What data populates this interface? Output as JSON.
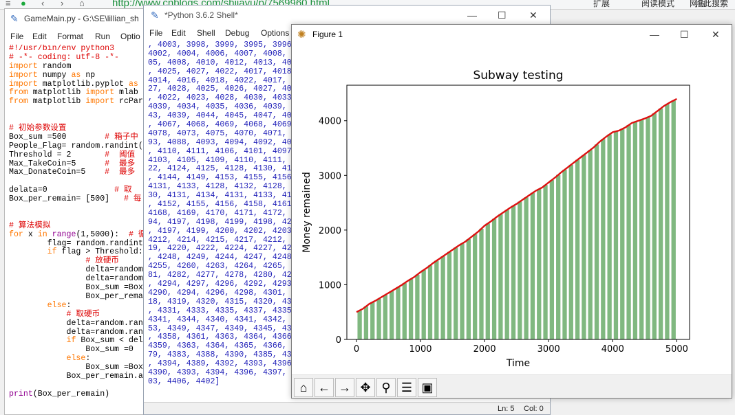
{
  "browser": {
    "url": "http://www.cnblogs.com/shiiayu/p/7569960.html",
    "right_items": [
      "扩展",
      "阅读模式",
      "网银",
      "点此搜索"
    ]
  },
  "editor": {
    "title": "GameMain.py - G:\\SE\\lillian_sh",
    "menu": [
      "File",
      "Edit",
      "Format",
      "Run",
      "Optio"
    ],
    "lines": [
      [
        [
          "cm",
          "#!/usr/bin/env python3"
        ]
      ],
      [
        [
          "cm",
          "# -*- coding: utf-8 -*-"
        ]
      ],
      [
        [
          "kw",
          "import"
        ],
        [
          "pl",
          " random"
        ]
      ],
      [
        [
          "kw",
          "import"
        ],
        [
          "pl",
          " numpy "
        ],
        [
          "kw",
          "as"
        ],
        [
          "pl",
          " np"
        ]
      ],
      [
        [
          "kw",
          "import"
        ],
        [
          "pl",
          " matplotlib.pyplot "
        ],
        [
          "kw",
          "as"
        ]
      ],
      [
        [
          "kw",
          "from"
        ],
        [
          "pl",
          " matplotlib "
        ],
        [
          "kw",
          "import"
        ],
        [
          "pl",
          " mlab"
        ]
      ],
      [
        [
          "kw",
          "from"
        ],
        [
          "pl",
          " matplotlib "
        ],
        [
          "kw",
          "import"
        ],
        [
          "pl",
          " rcPar"
        ]
      ],
      [
        [
          "pl",
          ""
        ]
      ],
      [
        [
          "pl",
          ""
        ]
      ],
      [
        [
          "cm",
          "# 初始参数设置"
        ]
      ],
      [
        [
          "pl",
          "Box_sum =500        "
        ],
        [
          "cm",
          "# 箱子中"
        ]
      ],
      [
        [
          "pl",
          "People_Flag= random.randint("
        ]
      ],
      [
        [
          "pl",
          "Threshold = 2       "
        ],
        [
          "cm",
          "#  阈值"
        ]
      ],
      [
        [
          "pl",
          "Max_TakeCoin=5      "
        ],
        [
          "cm",
          "#  最多"
        ]
      ],
      [
        [
          "pl",
          "Max_DonateCoin=5    "
        ],
        [
          "cm",
          "#  最多"
        ]
      ],
      [
        [
          "pl",
          ""
        ]
      ],
      [
        [
          "pl",
          "delata=0              "
        ],
        [
          "cm",
          "# 取"
        ]
      ],
      [
        [
          "pl",
          "Box_per_remain= [500]   "
        ],
        [
          "cm",
          "# 每"
        ]
      ],
      [
        [
          "pl",
          ""
        ]
      ],
      [
        [
          "pl",
          ""
        ]
      ],
      [
        [
          "cm",
          "# 算法模拟"
        ]
      ],
      [
        [
          "kw",
          "for"
        ],
        [
          "pl",
          " x "
        ],
        [
          "kw",
          "in"
        ],
        [
          "pl",
          " "
        ],
        [
          "bi",
          "range"
        ],
        [
          "pl",
          "(1,5000):  "
        ],
        [
          "cm",
          "# 循"
        ]
      ],
      [
        [
          "pl",
          "        flag= random.randint"
        ]
      ],
      [
        [
          "pl",
          "        "
        ],
        [
          "kw",
          "if"
        ],
        [
          "pl",
          " flag > Threshold:"
        ]
      ],
      [
        [
          "pl",
          "                "
        ],
        [
          "cm",
          "# 放硬币"
        ]
      ],
      [
        [
          "pl",
          "                delta=random"
        ]
      ],
      [
        [
          "pl",
          "                delta=random"
        ]
      ],
      [
        [
          "pl",
          "                Box_sum =Box"
        ]
      ],
      [
        [
          "pl",
          "                Box_per_rema"
        ]
      ],
      [
        [
          "pl",
          "        "
        ],
        [
          "kw",
          "else"
        ],
        [
          "pl",
          ":"
        ]
      ],
      [
        [
          "pl",
          "            "
        ],
        [
          "cm",
          "# 取硬币"
        ]
      ],
      [
        [
          "pl",
          "            delta=random.ran"
        ]
      ],
      [
        [
          "pl",
          "            delta=random.ran"
        ]
      ],
      [
        [
          "pl",
          "            "
        ],
        [
          "kw",
          "if"
        ],
        [
          "pl",
          " Box_sum < del"
        ]
      ],
      [
        [
          "pl",
          "                Box_sum =0"
        ]
      ],
      [
        [
          "pl",
          "            "
        ],
        [
          "kw",
          "else"
        ],
        [
          "pl",
          ":"
        ]
      ],
      [
        [
          "pl",
          "                Box_sum =Box"
        ]
      ],
      [
        [
          "pl",
          "            Box_per_remain.a"
        ]
      ],
      [
        [
          "pl",
          ""
        ]
      ],
      [
        [
          "bi",
          "print"
        ],
        [
          "pl",
          "(Box_per_remain)"
        ]
      ]
    ]
  },
  "shell": {
    "title": "*Python 3.6.2 Shell*",
    "menu": [
      "File",
      "Edit",
      "Shell",
      "Debug",
      "Options"
    ],
    "output": [
      ", 4003, 3998, 3999, 3995, 3996",
      "4002, 4004, 4006, 4007, 4008,",
      "05, 4008, 4010, 4012, 4013, 40",
      ", 4025, 4027, 4022, 4017, 4018",
      "4014, 4016, 4018, 4022, 4017,",
      "27, 4028, 4025, 4026, 4027, 40",
      ", 4022, 4023, 4028, 4030, 4033",
      "4039, 4034, 4035, 4036, 4039,",
      "43, 4039, 4044, 4045, 4047, 40",
      ", 4067, 4068, 4069, 4068, 4069",
      "4078, 4073, 4075, 4070, 4071,",
      "93, 4088, 4093, 4094, 4092, 40",
      ", 4110, 4111, 4106, 4101, 4097",
      "4103, 4105, 4109, 4110, 4111,",
      "22, 4124, 4125, 4128, 4130, 41",
      ", 4144, 4149, 4153, 4155, 4156",
      "4131, 4133, 4128, 4132, 4128,",
      "30, 4131, 4134, 4131, 4133, 41",
      ", 4152, 4155, 4156, 4158, 4161",
      "4168, 4169, 4170, 4171, 4172,",
      "94, 4197, 4198, 4199, 4198, 42",
      ", 4197, 4199, 4200, 4202, 4203",
      "4212, 4214, 4215, 4217, 4212,",
      "19, 4220, 4222, 4224, 4227, 42",
      ", 4248, 4249, 4244, 4247, 4248",
      "4255, 4260, 4263, 4264, 4265,",
      "81, 4282, 4277, 4278, 4280, 42",
      ", 4294, 4297, 4296, 4292, 4293",
      "4290, 4294, 4296, 4298, 4301,",
      "18, 4319, 4320, 4315, 4320, 43",
      ", 4331, 4333, 4335, 4337, 4335",
      "4341, 4344, 4340, 4341, 4342,",
      "53, 4349, 4347, 4349, 4345, 43",
      ", 4358, 4361, 4363, 4364, 4366",
      "4359, 4363, 4364, 4365, 4366,",
      "79, 4383, 4388, 4390, 4385, 43",
      ", 4394, 4389, 4392, 4393, 4396",
      "4390, 4393, 4394, 4396, 4397,",
      "03, 4406, 4402]"
    ],
    "status_ln": "Ln: 5",
    "status_col": "Col: 0"
  },
  "figure": {
    "title": "Figure 1",
    "toolbar": [
      "home-icon",
      "back-arrow-icon",
      "forward-arrow-icon",
      "pan-icon",
      "zoom-icon",
      "configure-subplots-icon",
      "save-icon"
    ],
    "colors": {
      "bar": "#80b880",
      "line": "#dd1111"
    }
  },
  "chart_data": {
    "type": "bar",
    "title": "Subway testing",
    "xlabel": "Time",
    "ylabel": "Money remained",
    "xlim": [
      -150,
      5200
    ],
    "ylim": [
      0,
      4650
    ],
    "xticks": [
      0,
      1000,
      2000,
      3000,
      4000,
      5000
    ],
    "yticks": [
      0,
      1000,
      2000,
      3000,
      4000
    ],
    "trend": [
      [
        0,
        500
      ],
      [
        100,
        560
      ],
      [
        200,
        650
      ],
      [
        300,
        710
      ],
      [
        400,
        780
      ],
      [
        500,
        850
      ],
      [
        600,
        920
      ],
      [
        700,
        990
      ],
      [
        800,
        1070
      ],
      [
        900,
        1140
      ],
      [
        1000,
        1230
      ],
      [
        1100,
        1310
      ],
      [
        1200,
        1400
      ],
      [
        1300,
        1480
      ],
      [
        1400,
        1560
      ],
      [
        1500,
        1640
      ],
      [
        1600,
        1720
      ],
      [
        1700,
        1790
      ],
      [
        1800,
        1880
      ],
      [
        1900,
        1970
      ],
      [
        2000,
        2080
      ],
      [
        2100,
        2160
      ],
      [
        2200,
        2250
      ],
      [
        2300,
        2330
      ],
      [
        2400,
        2410
      ],
      [
        2500,
        2480
      ],
      [
        2600,
        2560
      ],
      [
        2700,
        2640
      ],
      [
        2800,
        2720
      ],
      [
        2900,
        2780
      ],
      [
        3000,
        2870
      ],
      [
        3100,
        2960
      ],
      [
        3200,
        3060
      ],
      [
        3300,
        3150
      ],
      [
        3400,
        3240
      ],
      [
        3500,
        3330
      ],
      [
        3600,
        3420
      ],
      [
        3700,
        3510
      ],
      [
        3800,
        3620
      ],
      [
        3900,
        3710
      ],
      [
        4000,
        3790
      ],
      [
        4100,
        3820
      ],
      [
        4200,
        3880
      ],
      [
        4300,
        3960
      ],
      [
        4400,
        4000
      ],
      [
        4500,
        4040
      ],
      [
        4600,
        4090
      ],
      [
        4700,
        4180
      ],
      [
        4800,
        4270
      ],
      [
        4900,
        4340
      ],
      [
        5000,
        4400
      ]
    ]
  }
}
